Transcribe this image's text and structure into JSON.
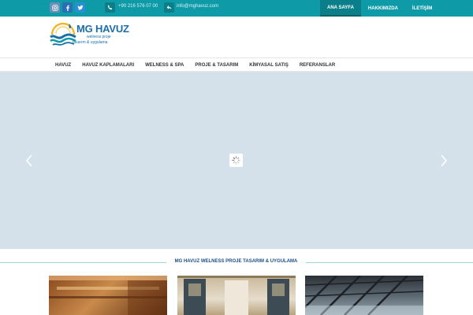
{
  "topbar": {
    "social_icons": [
      "instagram-icon",
      "facebook-icon",
      "twitter-icon"
    ],
    "phone": "+90 216 576 07 00",
    "email": "info@mghavuz.com",
    "nav": [
      {
        "label": "ANA SAYFA",
        "active": true
      },
      {
        "label": "HAKKIMIZDA",
        "active": false
      },
      {
        "label": "İLETİŞİM",
        "active": false
      }
    ]
  },
  "logo": {
    "brand": "MG HAVUZ",
    "tagline_1": "welness proje",
    "tagline_2": "tasarım & uygulama"
  },
  "main_nav": {
    "items": [
      "HAVUZ",
      "HAVUZ KAPLAMALARI",
      "WELNESS & SPA",
      "PROJE & TASARIM",
      "KİMYASAL SATIŞ",
      "REFERANSLAR"
    ]
  },
  "slider": {
    "prev_icon": "chevron-left-icon",
    "next_icon": "chevron-right-icon",
    "loader_icon": "spinner-icon"
  },
  "section": {
    "title": "MG HAVUZ WELNESS PROJE TASARIM & UYGULAMA"
  },
  "colors": {
    "topbar": "#0e9aa7",
    "accent_dark": "#0a7f89",
    "brand": "#1a6fa8",
    "section_title": "#1a4f88"
  }
}
